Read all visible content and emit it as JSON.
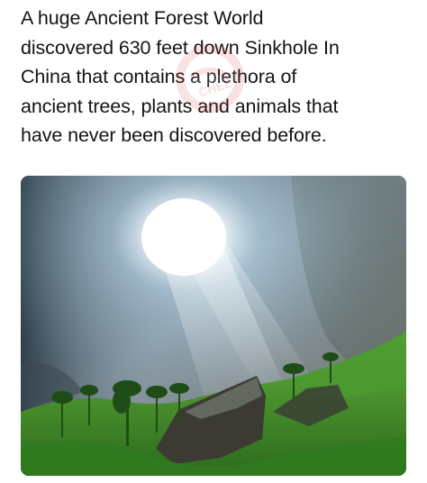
{
  "post": {
    "caption_lines": [
      "A huge Ancient Forest World",
      "discovered 630 feet down Sinkhole In",
      "China that contains a plethora of",
      "ancient trees, plants and animals that",
      "have never been discovered before."
    ]
  },
  "watermark": {
    "icon": "meme-logo-watermark",
    "text": "CHEE"
  },
  "photo": {
    "subject": "sinkhole-forest-photo",
    "colors": {
      "sky_light": "#ffffff",
      "rock": "#6d7f8d",
      "vegetation": "#3f8a2a"
    }
  }
}
